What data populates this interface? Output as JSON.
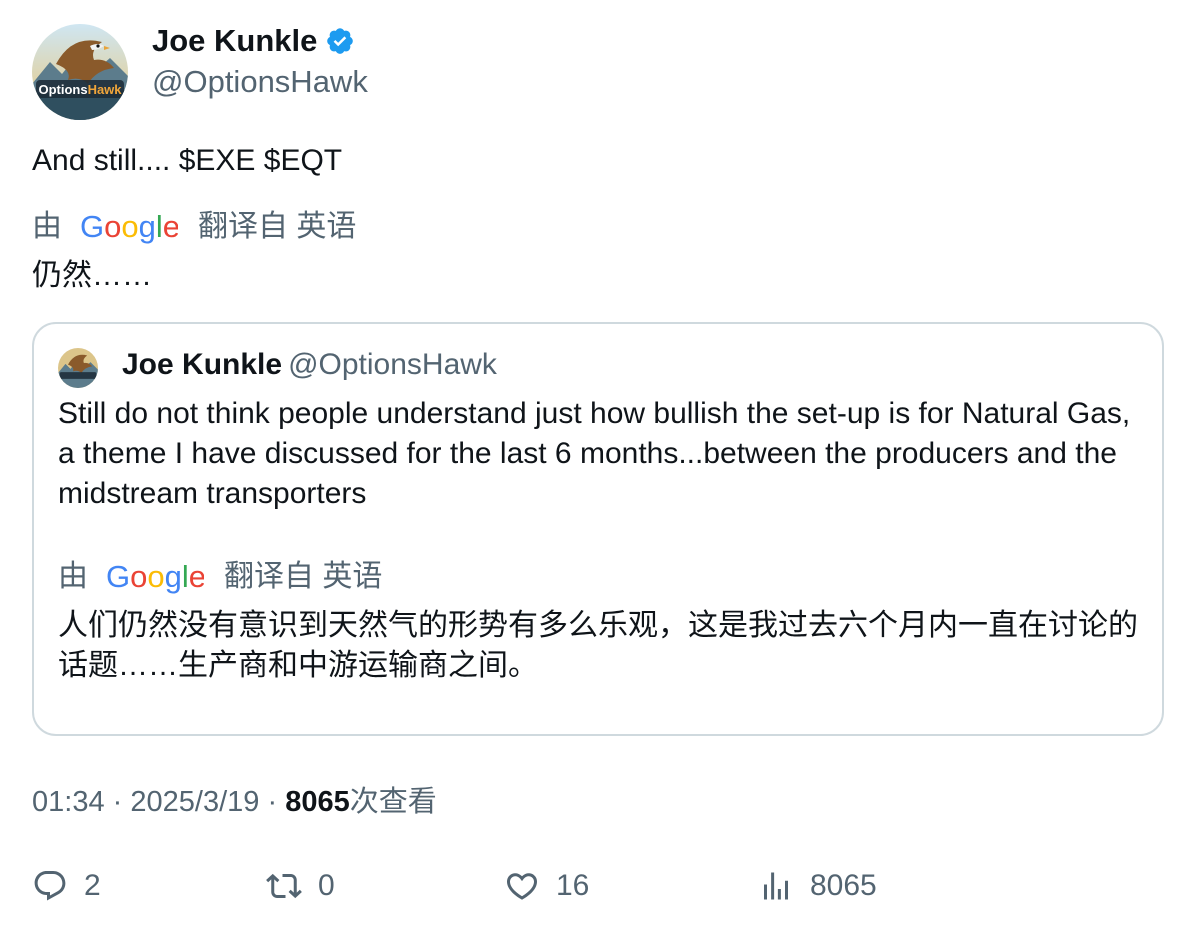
{
  "author": {
    "name": "Joe Kunkle",
    "handle": "@OptionsHawk",
    "avatar_brand_text": "OptionsHawk",
    "verified_color": "#1d9bf0"
  },
  "tweet": {
    "text": "And still.... $EXE $EQT",
    "translation": {
      "by": "由",
      "provider": "Google",
      "from": "翻译自 英语",
      "text": "仍然……"
    }
  },
  "quoted_tweet": {
    "name": "Joe Kunkle",
    "handle": "@OptionsHawk",
    "text": "Still do not think people understand just how bullish the set-up is for Natural Gas, a theme I have discussed for the last 6 months...between the producers and the midstream transporters",
    "translation": {
      "by": "由",
      "provider": "Google",
      "from": "翻译自 英语",
      "text": "人们仍然没有意识到天然气的形势有多么乐观，这是我过去六个月内一直在讨论的话题……生产商和中游运输商之间。"
    }
  },
  "meta": {
    "time": "01:34",
    "separator": "·",
    "date": "2025/3/19",
    "views_count": "8065",
    "views_label": "次查看"
  },
  "actions": {
    "reply_count": "2",
    "retweet_count": "0",
    "like_count": "16",
    "views_count": "8065"
  },
  "icons": {
    "reply": "reply-icon",
    "retweet": "retweet-icon",
    "like": "heart-icon",
    "views": "analytics-icon",
    "verified": "verified-badge-icon"
  },
  "colors": {
    "text_primary": "#0f1419",
    "text_secondary": "#536471",
    "border": "#cfd9de",
    "google_blue": "#4285F4",
    "google_red": "#EA4335",
    "google_yellow": "#FBBC05",
    "google_green": "#34A853"
  }
}
